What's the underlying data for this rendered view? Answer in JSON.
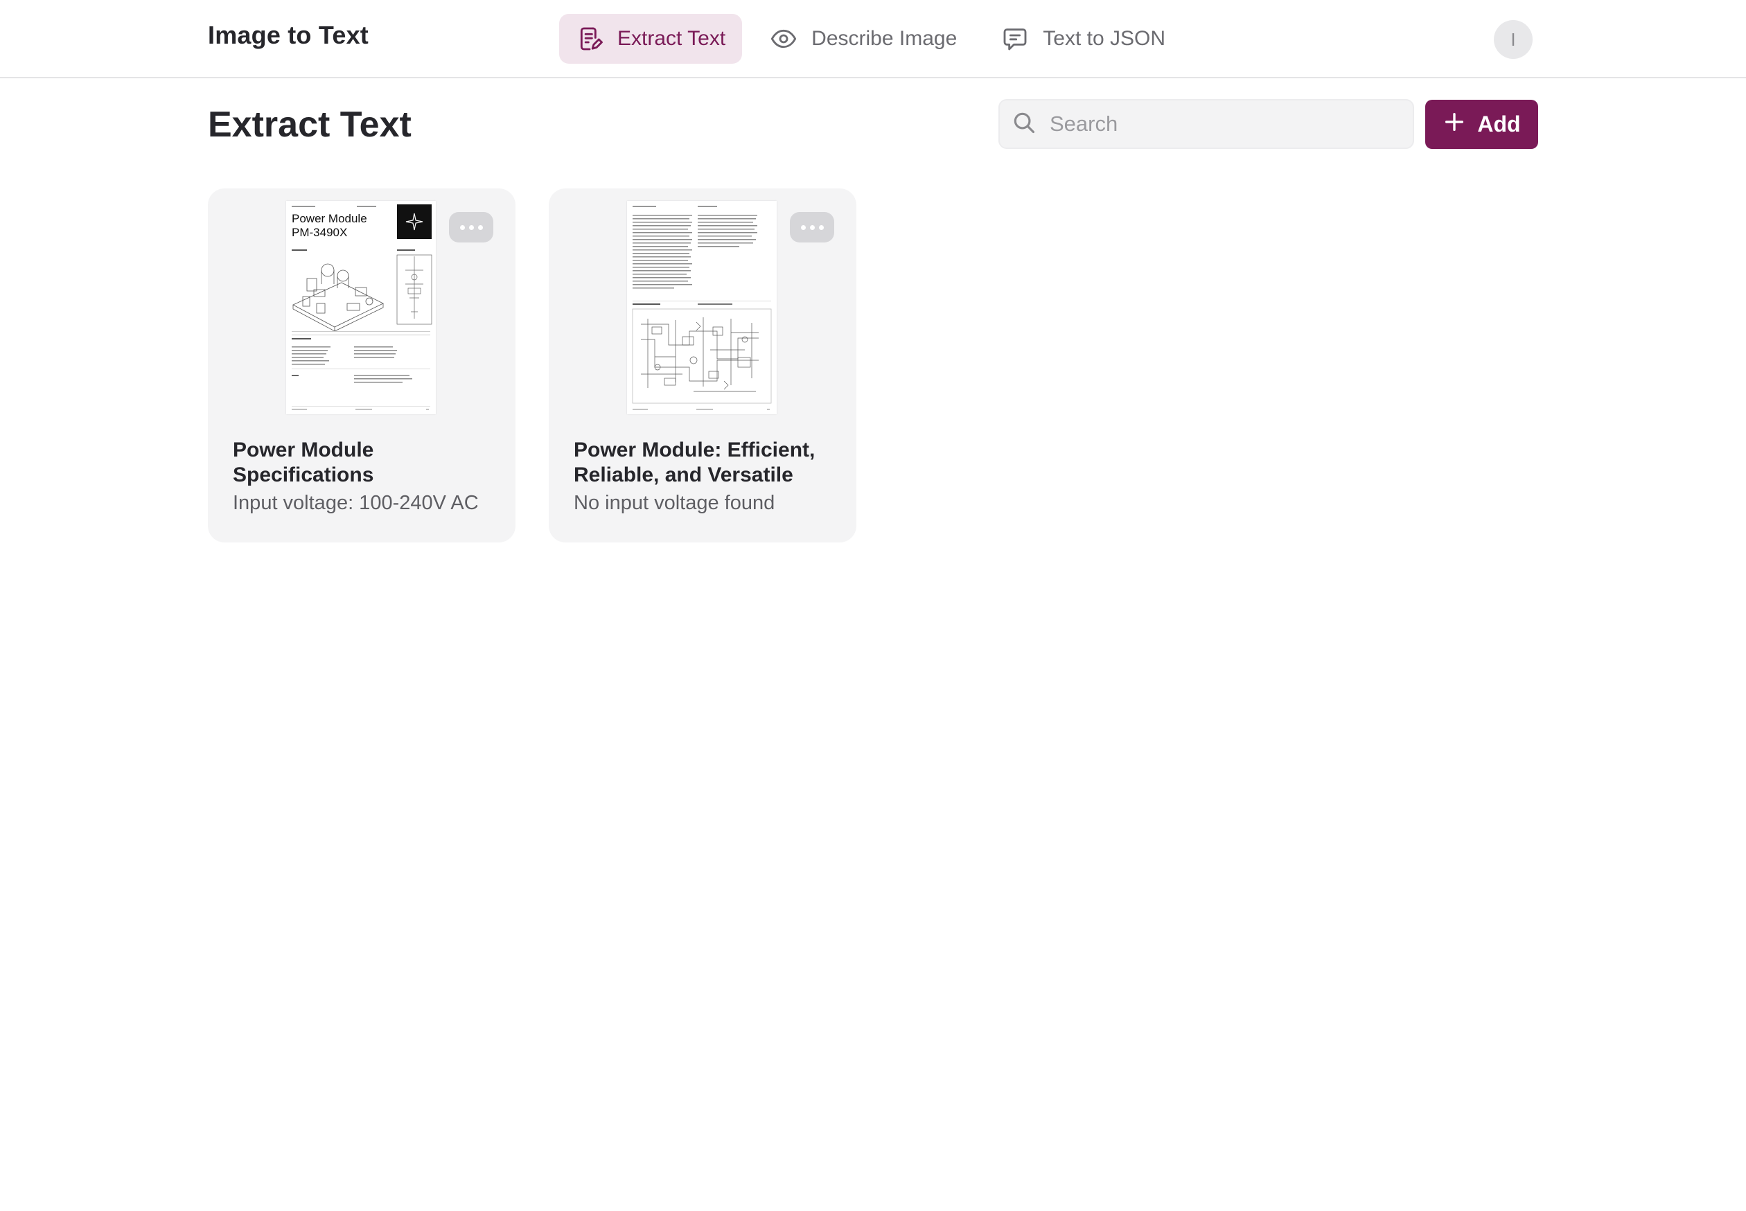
{
  "app": {
    "title": "Image to Text"
  },
  "nav": {
    "tabs": [
      {
        "label": "Extract Text",
        "icon": "document-text-icon",
        "active": true
      },
      {
        "label": "Describe Image",
        "icon": "eye-icon",
        "active": false
      },
      {
        "label": "Text to JSON",
        "icon": "chat-bubble-icon",
        "active": false
      }
    ]
  },
  "user": {
    "avatar_initial": "I"
  },
  "page": {
    "title": "Extract Text"
  },
  "search": {
    "placeholder": "Search",
    "value": ""
  },
  "toolbar": {
    "add_label": "Add"
  },
  "colors": {
    "accent": "#7a1a57",
    "active_tab_bg": "#f1e4ec"
  },
  "cards": [
    {
      "title": "Power Module Specifications",
      "subtitle": "Input voltage: 100-240V AC",
      "thumbnail": {
        "heading_line1": "Power Module",
        "heading_line2": "PM-3490X"
      }
    },
    {
      "title": "Power Module: Efficient, Reliable, and Versatile",
      "subtitle": "No input voltage found"
    }
  ]
}
